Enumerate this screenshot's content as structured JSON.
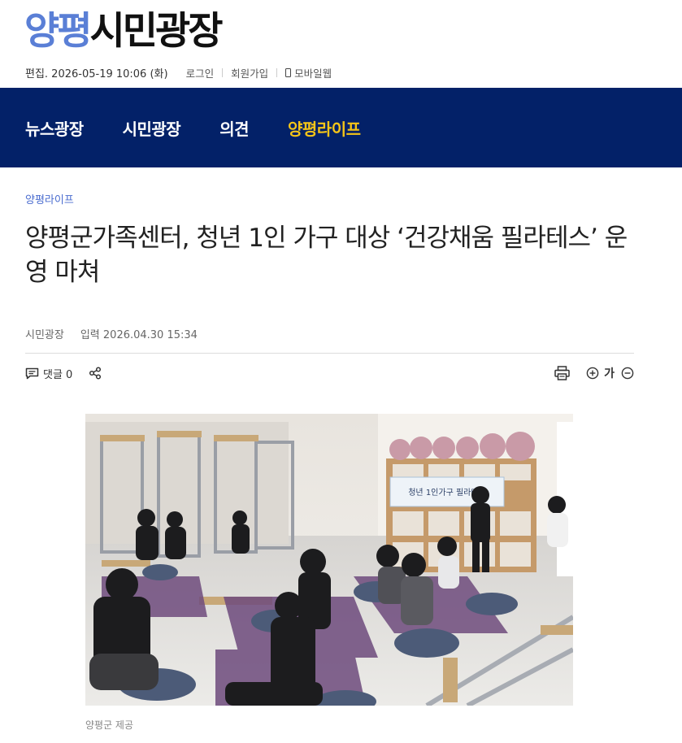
{
  "site": {
    "logo_part1": "양평",
    "logo_part2": "시민광장"
  },
  "topbar": {
    "edit_date": "편집. 2026-05-19 10:06 (화)",
    "login": "로그인",
    "signup": "회원가입",
    "mobile": "모바일웹"
  },
  "nav": [
    {
      "label": "뉴스광장"
    },
    {
      "label": "시민광장"
    },
    {
      "label": "의견"
    },
    {
      "label": "양평라이프",
      "active": true
    }
  ],
  "article": {
    "section": "양평라이프",
    "title": "양평군가족센터, 청년 1인 가구 대상 ‘건강채움 필라테스’ 운영 마쳐",
    "author": "시민광장",
    "published": "입력 2026.04.30 15:34",
    "comments": "댓글 0",
    "font_label": "가",
    "banner_text": "청년 1인가구 필라테스",
    "photo_caption": "양평군 제공"
  },
  "colors": {
    "nav_bg": "#032168",
    "nav_active": "#f5c518",
    "brand_blue": "#5a7fd6",
    "section_link": "#4a6ccf"
  },
  "icons": [
    "comment-icon",
    "share-icon",
    "print-icon",
    "zoom-in-icon",
    "zoom-out-icon",
    "phone-icon"
  ]
}
